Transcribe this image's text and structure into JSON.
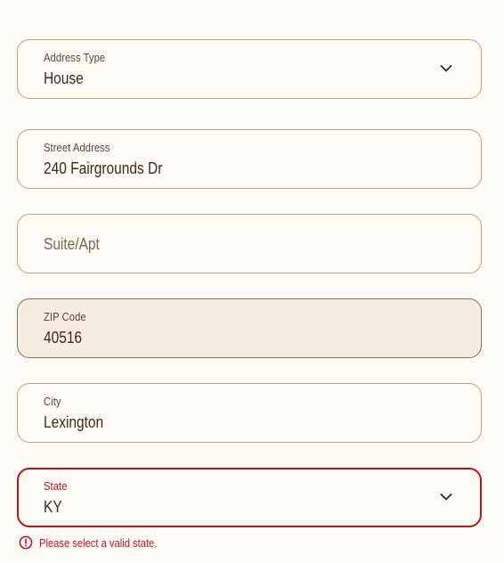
{
  "address_type": {
    "label": "Address Type",
    "value": "House"
  },
  "street_address": {
    "label": "Street Address",
    "value": "240 Fairgrounds Dr"
  },
  "suite_apt": {
    "placeholder": "Suite/Apt"
  },
  "zip_code": {
    "label": "ZIP Code",
    "value": "40516"
  },
  "city": {
    "label": "City",
    "value": "Lexington"
  },
  "state": {
    "label": "State",
    "value": "KY",
    "error": "Please select a valid state."
  },
  "colors": {
    "background": "#fdf9f4",
    "border": "#b8a491",
    "focused_background": "#f6ece2",
    "error": "#b3151d",
    "text": "#3b2a1f"
  },
  "icons": {
    "dropdown": "chevron-down-icon",
    "error": "alert-circle-icon"
  }
}
